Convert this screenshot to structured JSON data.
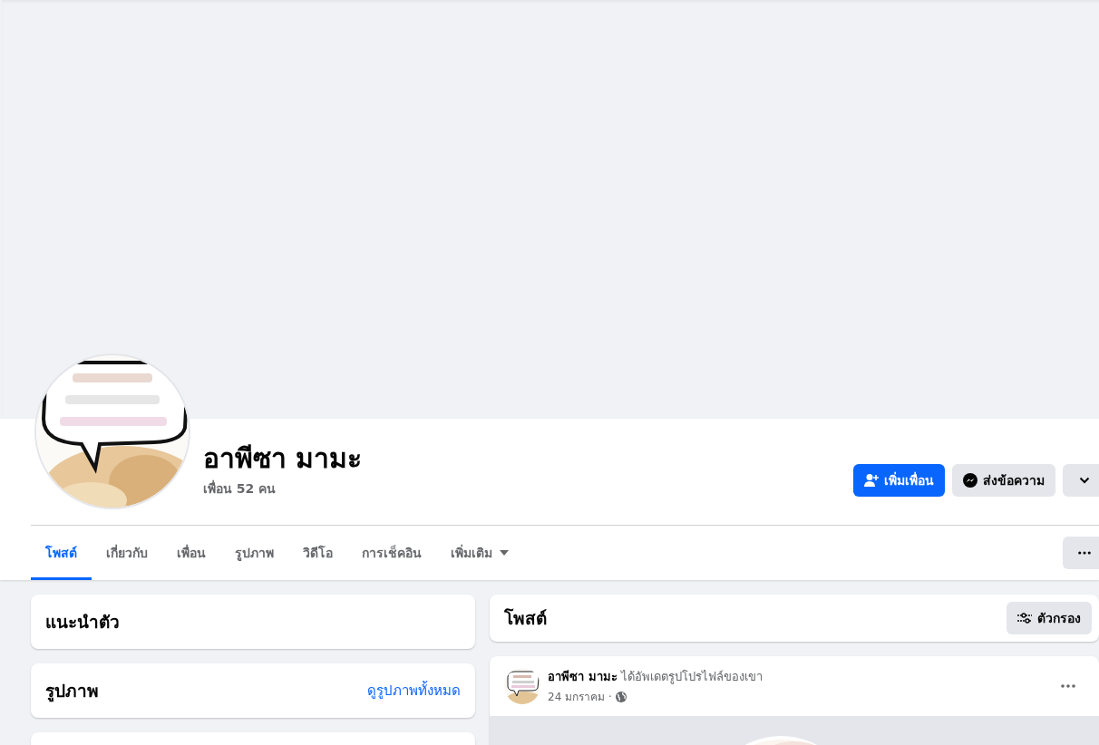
{
  "profile": {
    "name": "อาพีซา มามะ",
    "friends": "เพื่อน 52 คน"
  },
  "actions": [
    {
      "kind": "add-friend",
      "label": "เพิ่มเพื่อน"
    },
    {
      "kind": "message",
      "label": "ส่งข้อความ"
    },
    {
      "kind": "dropdown"
    }
  ],
  "tabs": [
    {
      "label": "โพสต์",
      "selected": true,
      "kind": "link"
    },
    {
      "label": "เกี่ยวกับ",
      "selected": false,
      "kind": "link"
    },
    {
      "label": "เพื่อน",
      "selected": false,
      "kind": "link"
    },
    {
      "label": "รูปภาพ",
      "selected": false,
      "kind": "link"
    },
    {
      "label": "วิดีโอ",
      "selected": false,
      "kind": "link"
    },
    {
      "label": "การเช็คอิน",
      "selected": false,
      "kind": "link"
    },
    {
      "label": "เพิ่มเติม",
      "selected": false,
      "kind": "menu"
    }
  ],
  "sidebar": {
    "cards": [
      {
        "kind": "titled",
        "title": "แนะนำตัว"
      },
      {
        "kind": "titled",
        "title": "รูปภาพ",
        "link": "ดูรูปภาพทั้งหมด"
      },
      {
        "kind": "blank"
      }
    ]
  },
  "posts": {
    "title": "โพสต์",
    "filter": "ตัวกรอง",
    "items": [
      {
        "author": "อาพีซา มามะ",
        "action": "ได้อัพเดตรูปโปรไฟล์ของเขา",
        "date": "24 มกราคม ·",
        "public": true
      }
    ]
  }
}
